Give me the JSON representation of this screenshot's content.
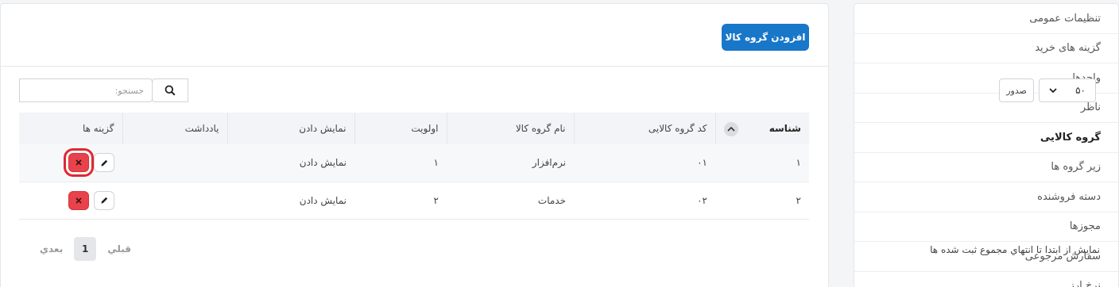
{
  "sidebar": {
    "items": [
      {
        "label": "تنظیمات عمومی"
      },
      {
        "label": "گزینه های خرید"
      },
      {
        "label": "واحدها"
      },
      {
        "label": "ناظر"
      },
      {
        "label": "گروه کالایی",
        "active": true
      },
      {
        "label": "زیر گروه ها"
      },
      {
        "label": "دسته فروشنده"
      },
      {
        "label": "مجوزها"
      },
      {
        "label": "سفارش مرجوعی"
      },
      {
        "label": "نرخ ارز"
      }
    ]
  },
  "header": {
    "add_button": "افزودن گروه کالا"
  },
  "controls": {
    "length_value": "۵۰",
    "length_label": "صدور",
    "search_placeholder": "جستجو:"
  },
  "table": {
    "columns": [
      "شناسه",
      "کد گروه کالایی",
      "نام گروه کالا",
      "اولویت",
      "نمایش دادن",
      "یادداشت",
      "گزینه ها"
    ],
    "rows": [
      {
        "id": "۱",
        "code": "۰۱",
        "name": "نرم‌افزار",
        "priority": "۱",
        "display": "نمایش دادن",
        "note": ""
      },
      {
        "id": "۲",
        "code": "۰۲",
        "name": "خدمات",
        "priority": "۲",
        "display": "نمایش دادن",
        "note": ""
      }
    ]
  },
  "footer": {
    "info": "نمایش از ابتدا تا انتهاي مجموع ثبت شده ها",
    "prev": "قبلي",
    "current_page": "1",
    "next": "بعدي"
  }
}
